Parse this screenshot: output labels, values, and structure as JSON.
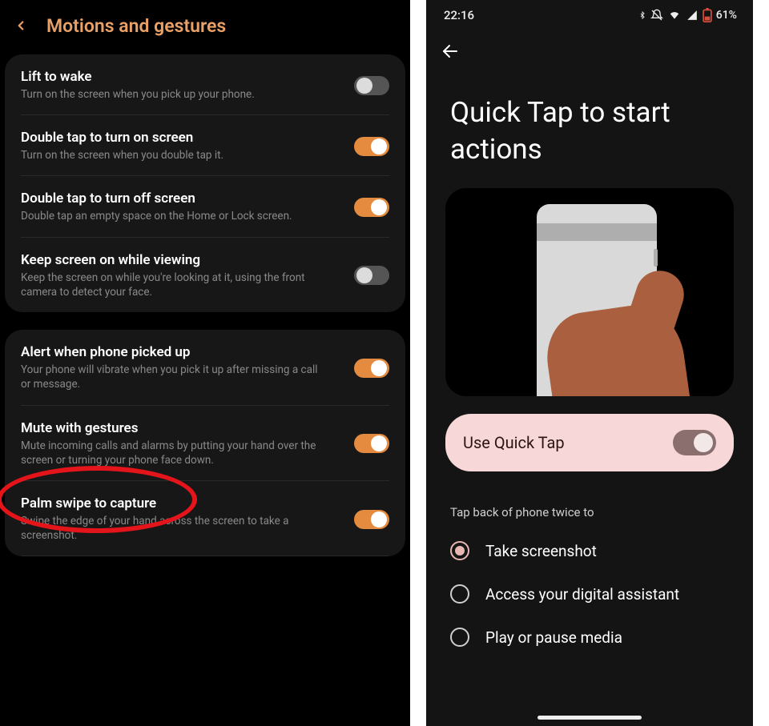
{
  "left": {
    "header_title": "Motions and gestures",
    "group1": [
      {
        "title": "Lift to wake",
        "sub": "Turn on the screen when you pick up your phone.",
        "on": false
      },
      {
        "title": "Double tap to turn on screen",
        "sub": "Turn on the screen when you double tap it.",
        "on": true
      },
      {
        "title": "Double tap to turn off screen",
        "sub": "Double tap an empty space on the Home or Lock screen.",
        "on": true
      },
      {
        "title": "Keep screen on while viewing",
        "sub": "Keep the screen on while you're looking at it, using the front camera to detect your face.",
        "on": false
      }
    ],
    "group2": [
      {
        "title": "Alert when phone picked up",
        "sub": "Your phone will vibrate when you pick it up after missing a call or message.",
        "on": true
      },
      {
        "title": "Mute with gestures",
        "sub": "Mute incoming calls and alarms by putting your hand over the screen or turning your phone face down.",
        "on": true
      },
      {
        "title": "Palm swipe to capture",
        "sub": "Swipe the edge of your hand across the screen to take a screenshot.",
        "on": true
      }
    ],
    "highlight_index": 2
  },
  "right": {
    "status_time": "22:16",
    "status_battery": "61%",
    "page_title": "Quick Tap to start actions",
    "toggle_label": "Use Quick Tap",
    "toggle_on": true,
    "section_label": "Tap back of phone twice to",
    "options": [
      {
        "label": "Take screenshot",
        "selected": true
      },
      {
        "label": "Access your digital assistant",
        "selected": false
      },
      {
        "label": "Play or pause media",
        "selected": false
      }
    ]
  }
}
